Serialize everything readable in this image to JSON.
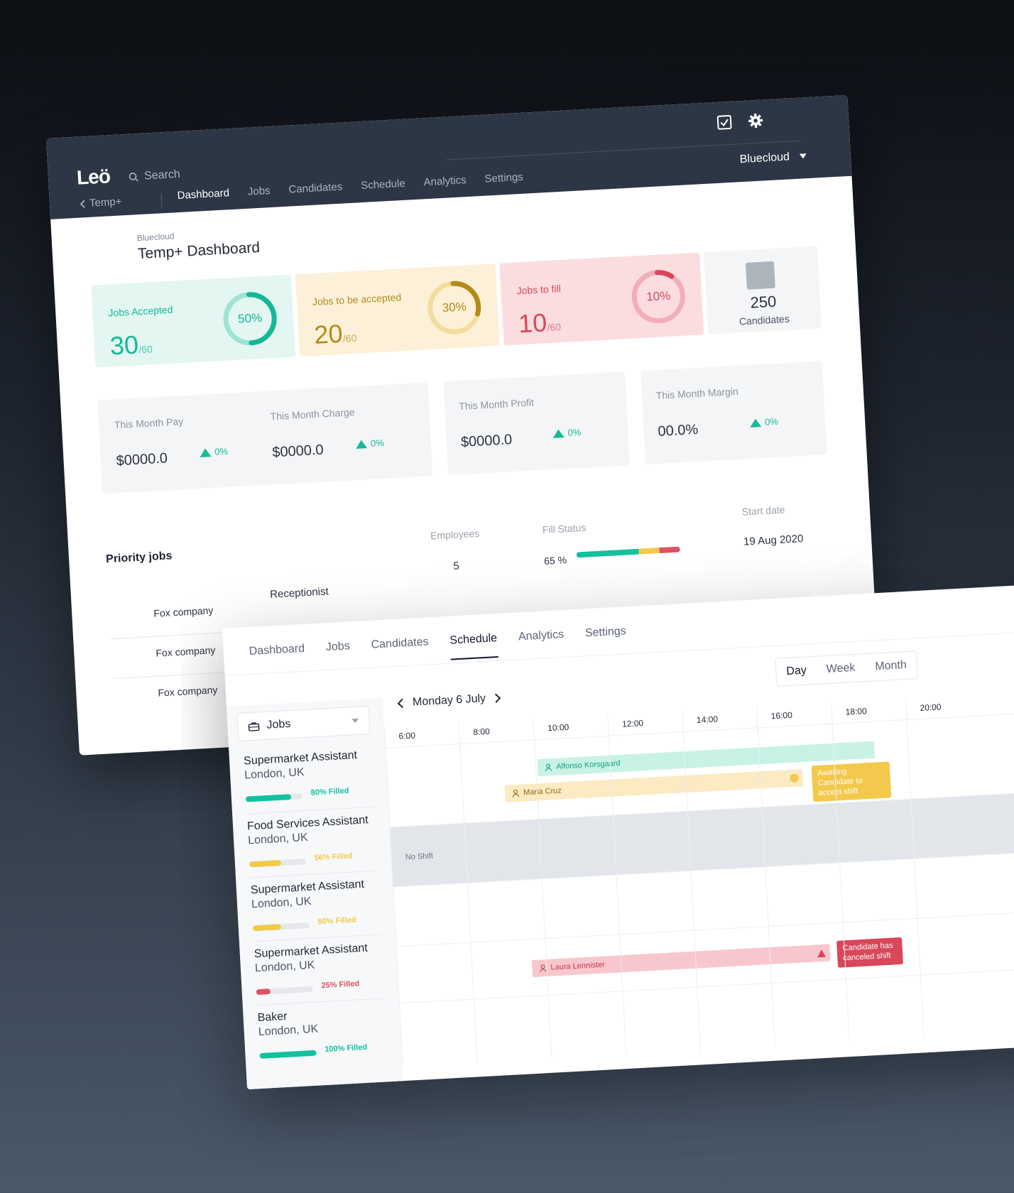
{
  "dashboard": {
    "logo": "Leö",
    "search_placeholder": "Search",
    "account": "Bluecloud",
    "back_label": "Temp+",
    "nav": [
      "Dashboard",
      "Jobs",
      "Candidates",
      "Schedule",
      "Analytics",
      "Settings"
    ],
    "nav_active": "Dashboard",
    "breadcrumb": "Bluecloud",
    "title": "Temp+ Dashboard",
    "kpis": [
      {
        "label": "Jobs Accepted",
        "value": "30",
        "denominator": "/60",
        "percent_label": "50%",
        "percent": 50,
        "color": "#13b897",
        "track": "#9fe3d5"
      },
      {
        "label": "Jobs to be accepted",
        "value": "20",
        "denominator": "/60",
        "percent_label": "30%",
        "percent": 30,
        "color": "#b28b19",
        "track": "#f3dd9d"
      },
      {
        "label": "Jobs to fill",
        "value": "10",
        "denominator": "/60",
        "percent_label": "10%",
        "percent": 10,
        "color": "#d8475a",
        "track": "#f3aeb8"
      }
    ],
    "candidates": {
      "count": "250",
      "label": "Candidates"
    },
    "stats": [
      {
        "label": "This Month Pay",
        "value": "$0000.0",
        "delta": "0%"
      },
      {
        "label": "This Month Charge",
        "value": "$0000.0",
        "delta": "0%"
      },
      {
        "label": "This Month Profit",
        "value": "$0000.0",
        "delta": "0%"
      },
      {
        "label": "This Month Margin",
        "value": "00.0%",
        "delta": "0%"
      }
    ],
    "priority": {
      "title": "Priority jobs",
      "headers": {
        "employees": "Employees",
        "fill_status": "Fill Status",
        "start_date": "Start date"
      },
      "first_row": {
        "role": "Receptionist",
        "employees": "5",
        "fill_label": "65 %",
        "start_date": "19 Aug 2020"
      },
      "fill_segments": [
        {
          "color": "#13c19f",
          "share": 0.6
        },
        {
          "color": "#f2c94c",
          "share": 0.2
        },
        {
          "color": "#e0525f",
          "share": 0.2
        }
      ],
      "companies": [
        "Fox company",
        "Fox company",
        "Fox company"
      ]
    }
  },
  "schedule": {
    "tabs": [
      "Dashboard",
      "Jobs",
      "Candidates",
      "Schedule",
      "Analytics",
      "Settings"
    ],
    "tab_active": "Schedule",
    "ranges": [
      "Day",
      "Week",
      "Month"
    ],
    "range_active": "Day",
    "filter_label": "Jobs",
    "date_label": "Monday 6 July",
    "times": [
      "6:00",
      "8:00",
      "10:00",
      "12:00",
      "14:00",
      "16:00",
      "18:00",
      "20:00"
    ],
    "jobs": [
      {
        "title": "Supermarket Assistant",
        "location": "London, UK",
        "filled_label": "80% Filled",
        "filled": 0.8,
        "color": "#13c19f"
      },
      {
        "title": "Food Services Assistant",
        "location": "London, UK",
        "filled_label": "56% Filled",
        "filled": 0.56,
        "color": "#f2c94c"
      },
      {
        "title": "Supermarket Assistant",
        "location": "London, UK",
        "filled_label": "50% Filled",
        "filled": 0.5,
        "color": "#f2c94c"
      },
      {
        "title": "Supermarket Assistant",
        "location": "London, UK",
        "filled_label": "25% Filled",
        "filled": 0.25,
        "color": "#e0525f"
      },
      {
        "title": "Baker",
        "location": "London, UK",
        "filled_label": "100% Filled",
        "filled": 1.0,
        "color": "#13c19f"
      }
    ],
    "no_shift": "No Shift",
    "shifts": [
      {
        "name": "Alfonso Korsgaard",
        "color": "#c9f2e6",
        "text": "#0f9f83"
      },
      {
        "name": "Maria Cruz",
        "color": "#fbeac2",
        "text": "#8a6a10"
      },
      {
        "name": "Laura Lennister",
        "color": "#f8c7cd",
        "text": "#c23a4d"
      }
    ],
    "callouts": {
      "awaiting": "Awaiting Candidate to accept shift",
      "canceled": "Candidate has canceled shift"
    }
  }
}
